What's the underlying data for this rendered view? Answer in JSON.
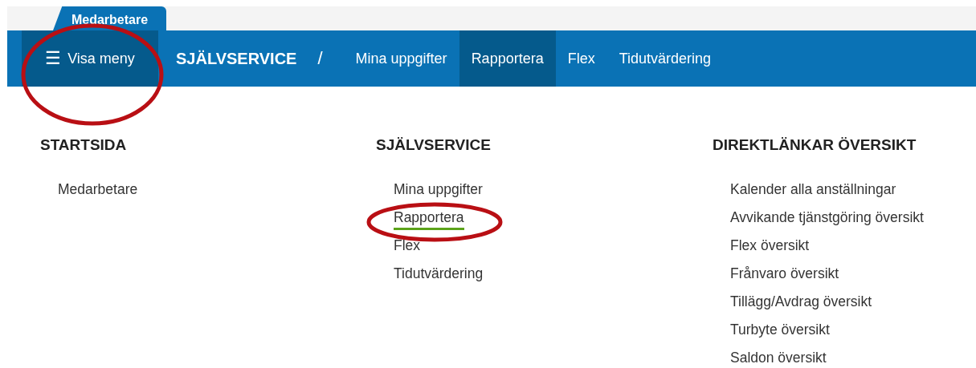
{
  "tabs": [
    {
      "label": "Medarbetare",
      "selected": true
    }
  ],
  "menu_button": {
    "icon": "☰",
    "label": "Visa meny",
    "circled": true
  },
  "breadcrumb": {
    "title": "SJÄLVSERVICE",
    "separator": "/"
  },
  "nav": [
    {
      "label": "Mina uppgifter",
      "selected": false
    },
    {
      "label": "Rapportera",
      "selected": true
    },
    {
      "label": "Flex",
      "selected": false
    },
    {
      "label": "Tidutvärdering",
      "selected": false
    }
  ],
  "columns": [
    {
      "heading": "STARTSIDA",
      "items": [
        {
          "label": "Medarbetare",
          "selected": false,
          "circled": false
        }
      ]
    },
    {
      "heading": "SJÄLVSERVICE",
      "items": [
        {
          "label": "Mina uppgifter",
          "selected": false,
          "circled": false
        },
        {
          "label": "Rapportera",
          "selected": true,
          "circled": true
        },
        {
          "label": "Flex",
          "selected": false,
          "circled": false
        },
        {
          "label": "Tidutvärdering",
          "selected": false,
          "circled": false
        }
      ]
    },
    {
      "heading": "DIREKTLÄNKAR ÖVERSIKT",
      "items": [
        {
          "label": "Kalender alla anställningar",
          "selected": false,
          "circled": false
        },
        {
          "label": "Avvikande tjänstgöring översikt",
          "selected": false,
          "circled": false
        },
        {
          "label": "Flex översikt",
          "selected": false,
          "circled": false
        },
        {
          "label": "Frånvaro översikt",
          "selected": false,
          "circled": false
        },
        {
          "label": "Tillägg/Avdrag översikt",
          "selected": false,
          "circled": false
        },
        {
          "label": "Turbyte översikt",
          "selected": false,
          "circled": false
        },
        {
          "label": "Saldon översikt",
          "selected": false,
          "circled": false
        }
      ]
    }
  ]
}
